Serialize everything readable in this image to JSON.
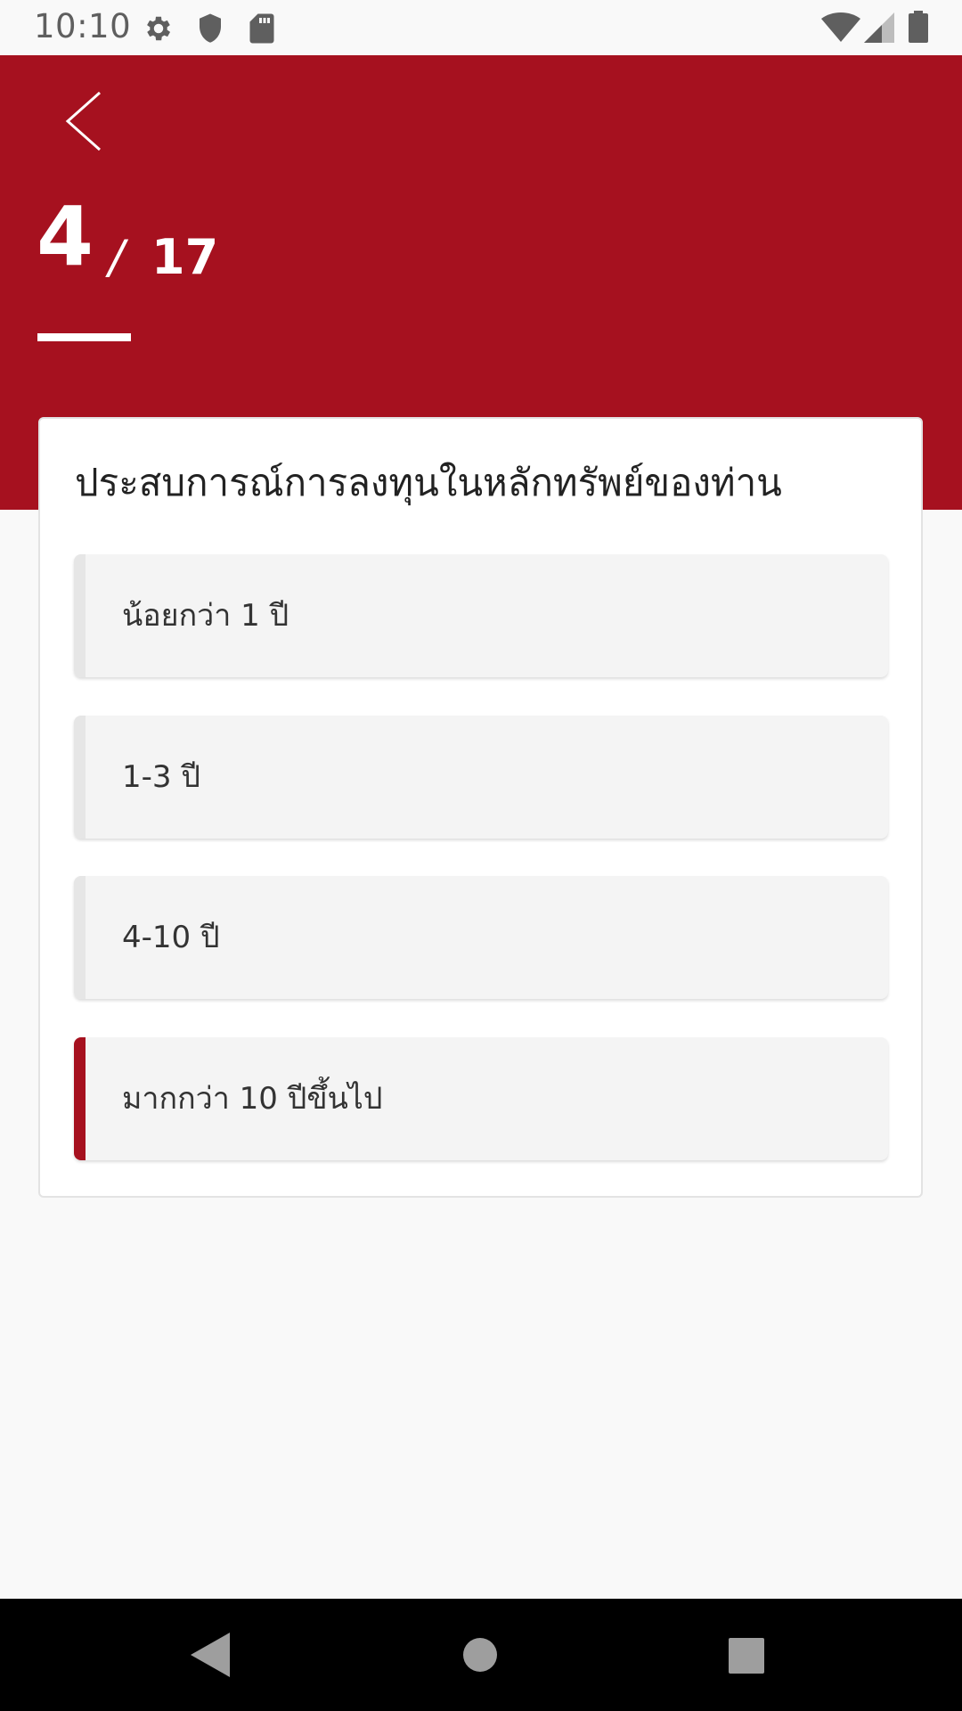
{
  "status_bar": {
    "time": "10:10",
    "icons": [
      "gear-icon",
      "shield-icon",
      "sd-card-icon",
      "wifi-icon",
      "cell-signal-icon",
      "battery-icon"
    ]
  },
  "header": {
    "back_icon": "chevron-left-icon",
    "step_current": "4",
    "step_separator": "/",
    "step_total": "17",
    "color": "#a6111f"
  },
  "question": {
    "text": "ประสบการณ์การลงทุนในหลักทรัพย์ของท่าน",
    "options": [
      {
        "label": "น้อยกว่า 1 ปี",
        "selected": false
      },
      {
        "label": "1-3 ปี",
        "selected": false
      },
      {
        "label": "4-10 ปี",
        "selected": false
      },
      {
        "label": "มากกว่า 10 ปีขึ้นไป",
        "selected": true
      }
    ]
  },
  "nav_bar": {
    "icons": [
      "back-triangle-icon",
      "home-circle-icon",
      "recents-square-icon"
    ]
  },
  "colors": {
    "accent": "#a6111f",
    "option_bg": "#f4f4f4",
    "page_bg": "#f9f9f9"
  }
}
